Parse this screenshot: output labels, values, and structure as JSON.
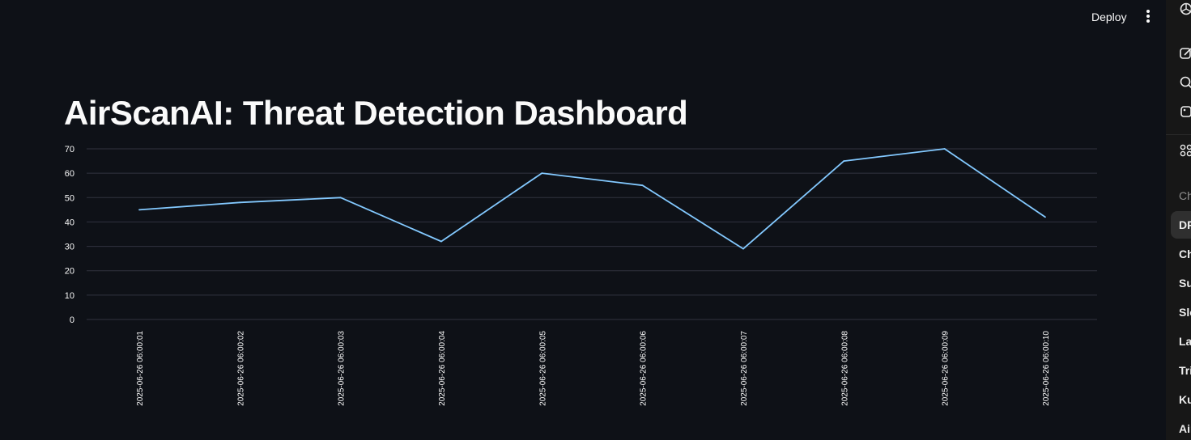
{
  "header": {
    "deploy_label": "Deploy"
  },
  "page": {
    "title": "AirScanAI: Threat Detection Dashboard"
  },
  "chart_data": {
    "type": "line",
    "x": [
      "2025-06-26 06:00:01",
      "2025-06-26 06:00:02",
      "2025-06-26 06:00:03",
      "2025-06-26 06:00:04",
      "2025-06-26 06:00:05",
      "2025-06-26 06:00:06",
      "2025-06-26 06:00:07",
      "2025-06-26 06:00:08",
      "2025-06-26 06:00:09",
      "2025-06-26 06:00:10"
    ],
    "series": [
      {
        "values": [
          45,
          48,
          50,
          32,
          60,
          55,
          29,
          65,
          70,
          42
        ]
      }
    ],
    "yticks": [
      0,
      10,
      20,
      30,
      40,
      50,
      60,
      70
    ],
    "ylim": [
      0,
      70
    ],
    "grid": true,
    "line_color": "#83c9ff",
    "grid_color": "#31333f",
    "tick_color": "#fafafa"
  },
  "side_panel": {
    "heading": "Ch",
    "items": [
      "DP",
      "Ch",
      "Su",
      "Slo",
      "La",
      "Tri",
      "Ku",
      "Air"
    ]
  }
}
